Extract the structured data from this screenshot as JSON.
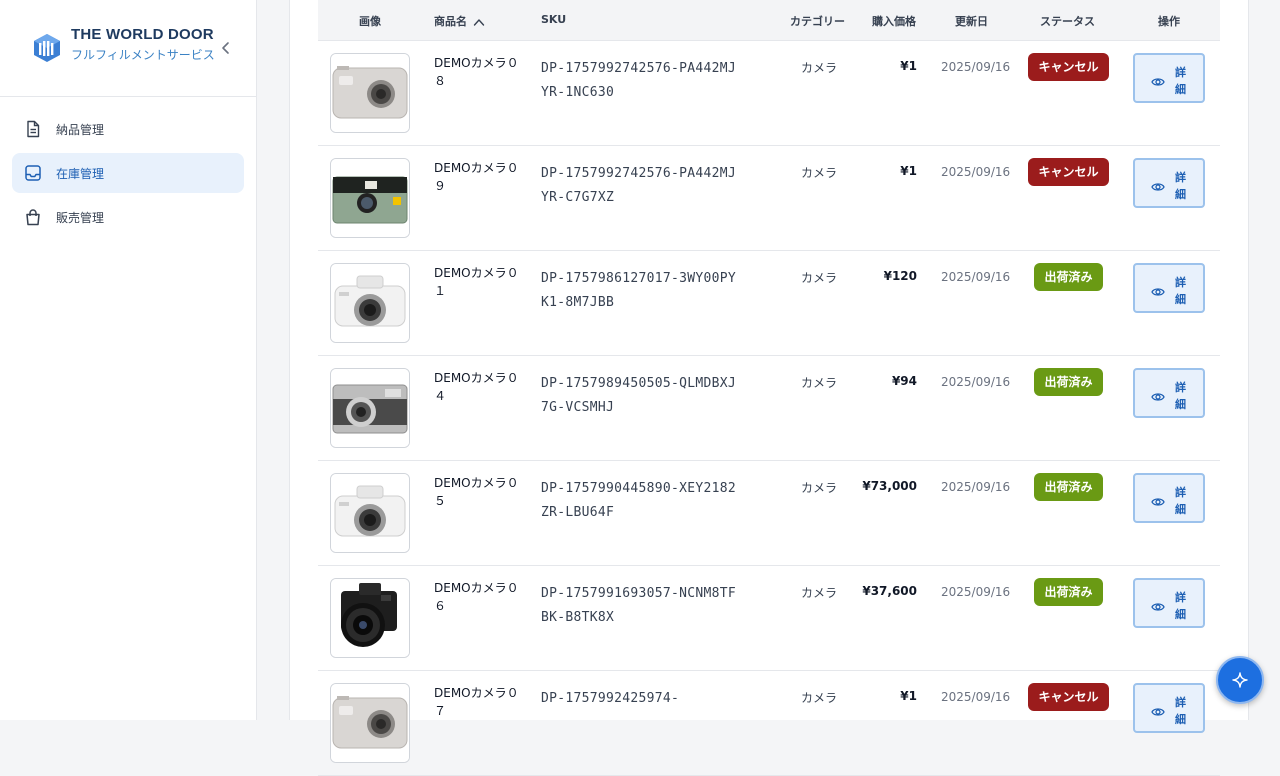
{
  "brand": {
    "title": "THE WORLD DOOR",
    "subtitle": "フルフィルメントサービス"
  },
  "sidebar": {
    "items": [
      {
        "label": "納品管理",
        "icon": "document-icon",
        "active": false
      },
      {
        "label": "在庫管理",
        "icon": "inbox-icon",
        "active": true
      },
      {
        "label": "販売管理",
        "icon": "shopping-bag-icon",
        "active": false
      }
    ]
  },
  "table": {
    "headers": {
      "image": "画像",
      "name": "商品名",
      "sku": "SKU",
      "category": "カテゴリー",
      "price": "購入価格",
      "updated": "更新日",
      "status": "ステータス",
      "actions": "操作"
    },
    "detail_label": "詳細",
    "rows": [
      {
        "name": "DEMOカメラ０８",
        "sku": "DP-1757992742576-PA442MJYR-1NC630",
        "category": "カメラ",
        "price": "¥1",
        "updated": "2025/09/16",
        "status": "キャンセル",
        "status_type": "cancel",
        "thumb": "compact-silver"
      },
      {
        "name": "DEMOカメラ０９",
        "sku": "DP-1757992742576-PA442MJYR-C7G7XZ",
        "category": "カメラ",
        "price": "¥1",
        "updated": "2025/09/16",
        "status": "キャンセル",
        "status_type": "cancel",
        "thumb": "film-green"
      },
      {
        "name": "DEMOカメラ０１",
        "sku": "DP-1757986127017-3WY00PYK1-8M7JBB",
        "category": "カメラ",
        "price": "¥120",
        "updated": "2025/09/16",
        "status": "出荷済み",
        "status_type": "shipped",
        "thumb": "mirrorless-white"
      },
      {
        "name": "DEMOカメラ０４",
        "sku": "DP-1757989450505-QLMDBXJ7G-VCSMHJ",
        "category": "カメラ",
        "price": "¥94",
        "updated": "2025/09/16",
        "status": "出荷済み",
        "status_type": "shipped",
        "thumb": "retro-silver"
      },
      {
        "name": "DEMOカメラ０５",
        "sku": "DP-1757990445890-XEY2182ZR-LBU64F",
        "category": "カメラ",
        "price": "¥73,000",
        "updated": "2025/09/16",
        "status": "出荷済み",
        "status_type": "shipped",
        "thumb": "mirrorless-white"
      },
      {
        "name": "DEMOカメラ０６",
        "sku": "DP-1757991693057-NCNM8TFBK-B8TK8X",
        "category": "カメラ",
        "price": "¥37,600",
        "updated": "2025/09/16",
        "status": "出荷済み",
        "status_type": "shipped",
        "thumb": "fullframe-black"
      },
      {
        "name": "DEMOカメラ０７",
        "sku": "DP-1757992425974-",
        "category": "カメラ",
        "price": "¥1",
        "updated": "2025/09/16",
        "status": "キャンセル",
        "status_type": "cancel",
        "thumb": "compact-silver"
      }
    ]
  },
  "colors": {
    "accent": "#1d5fb3",
    "cancel": "#9b1c1c",
    "shipped": "#6a9a14",
    "fab": "#1d6fe0"
  }
}
